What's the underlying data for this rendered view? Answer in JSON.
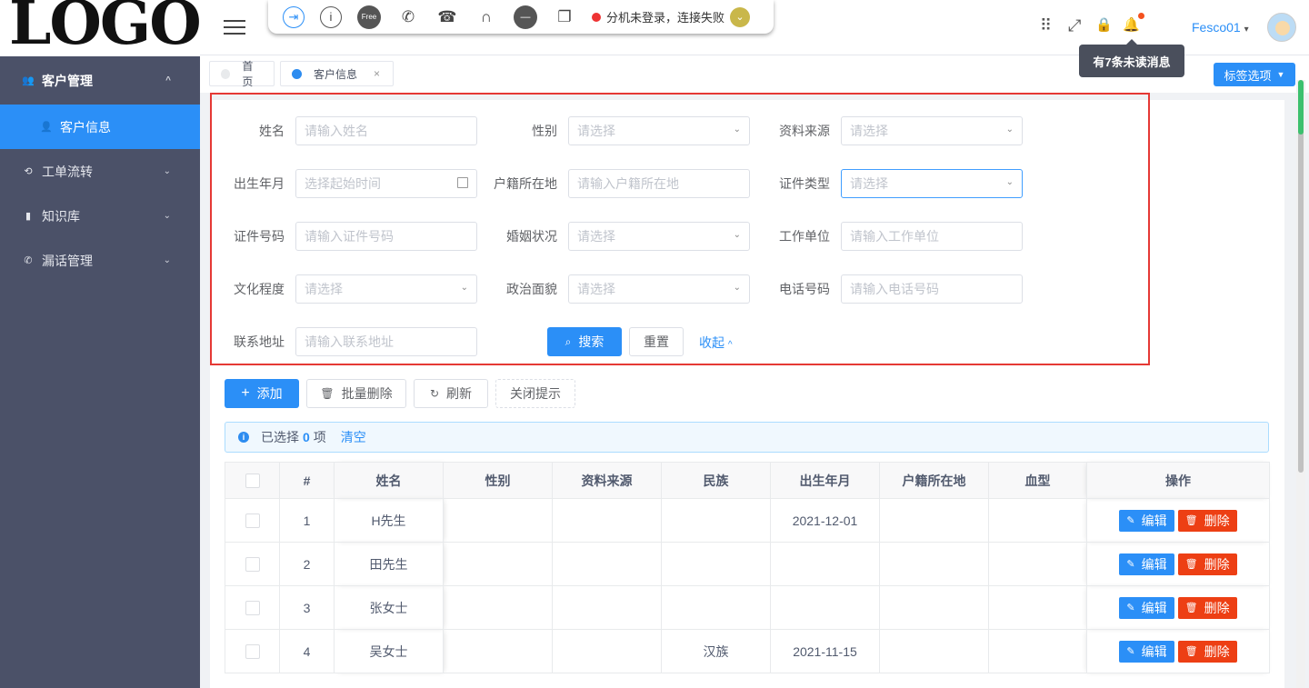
{
  "logo": {
    "text": "LOGO"
  },
  "sidebar": {
    "items": [
      {
        "label": "客户管理",
        "icon": "users-icon",
        "glyph": "👥",
        "chevron": "^"
      },
      {
        "label": "客户信息",
        "icon": "user-add-icon",
        "glyph": "👤"
      },
      {
        "label": "工单流转",
        "icon": "workflow-icon",
        "glyph": "⟲",
        "chevron": "⌄"
      },
      {
        "label": "知识库",
        "icon": "book-icon",
        "glyph": "▮",
        "chevron": "⌄"
      },
      {
        "label": "漏话管理",
        "icon": "phone-icon",
        "glyph": "✆",
        "chevron": "⌄"
      }
    ]
  },
  "toolbar": {
    "icons": [
      {
        "name": "login-icon",
        "glyph": "⇥"
      },
      {
        "name": "info-icon",
        "glyph": "i"
      },
      {
        "name": "free-icon",
        "glyph": "Free"
      },
      {
        "name": "phone-icon",
        "glyph": "✆"
      },
      {
        "name": "hangup-icon",
        "glyph": "☎"
      },
      {
        "name": "headset-icon",
        "glyph": "∩"
      },
      {
        "name": "minus-circle-icon",
        "glyph": "—"
      },
      {
        "name": "copy-icon",
        "glyph": "❐"
      }
    ],
    "status_text": "分机未登录，连接失败",
    "status_icon": "chevron-down-icon",
    "status_glyph": "⌄"
  },
  "header": {
    "username": "Fesco01",
    "username_caret": "▾",
    "tooltip": "有7条未读消息",
    "right_icons": [
      {
        "name": "apps-icon",
        "glyph": "⠿"
      },
      {
        "name": "fullscreen-icon",
        "glyph": "⤢"
      },
      {
        "name": "lock-icon",
        "glyph": "🔒"
      },
      {
        "name": "bell-icon",
        "glyph": "🔔"
      }
    ]
  },
  "tabs": {
    "items": [
      {
        "label": "首页",
        "active": false
      },
      {
        "label": "客户信息",
        "active": true,
        "close": "×"
      }
    ],
    "options_label": "标签选项",
    "options_caret": "▼"
  },
  "search": {
    "fields": [
      {
        "label": "姓名",
        "placeholder": "请输入姓名",
        "type": "input"
      },
      {
        "label": "性别",
        "placeholder": "请选择",
        "type": "select"
      },
      {
        "label": "资料来源",
        "placeholder": "请选择",
        "type": "select"
      },
      {
        "label": "出生年月",
        "placeholder": "选择起始时间",
        "type": "date"
      },
      {
        "label": "户籍所在地",
        "placeholder": "请输入户籍所在地",
        "type": "input"
      },
      {
        "label": "证件类型",
        "placeholder": "请选择",
        "type": "select"
      },
      {
        "label": "证件号码",
        "placeholder": "请输入证件号码",
        "type": "input"
      },
      {
        "label": "婚姻状况",
        "placeholder": "请选择",
        "type": "select"
      },
      {
        "label": "工作单位",
        "placeholder": "请输入工作单位",
        "type": "input"
      },
      {
        "label": "文化程度",
        "placeholder": "请选择",
        "type": "select"
      },
      {
        "label": "政治面貌",
        "placeholder": "请选择",
        "type": "select"
      },
      {
        "label": "电话号码",
        "placeholder": "请输入电话号码",
        "type": "input"
      },
      {
        "label": "联系地址",
        "placeholder": "请输入联系地址",
        "type": "input"
      }
    ],
    "search_label": "搜索",
    "reset_label": "重置",
    "collapse_label": "收起",
    "collapse_caret": "^",
    "select_caret": "⌄"
  },
  "actions": {
    "add_label": "添加",
    "add_glyph": "+",
    "batch_delete_label": "批量删除",
    "batch_delete_glyph": "🗑",
    "refresh_label": "刷新",
    "refresh_glyph": "↻",
    "close_hint_label": "关闭提示"
  },
  "alert": {
    "prefix": "已选择",
    "count": "0",
    "suffix": "项",
    "clear_label": "清空",
    "icon_glyph": "i"
  },
  "table": {
    "columns": [
      "#",
      "姓名",
      "性别",
      "资料来源",
      "民族",
      "出生年月",
      "户籍所在地",
      "血型",
      "操作"
    ],
    "rows": [
      {
        "idx": "1",
        "name": "H先生",
        "gender": "",
        "source": "",
        "ethnic": "",
        "birth": "2021-12-01",
        "hukou": "",
        "blood": ""
      },
      {
        "idx": "2",
        "name": "田先生",
        "gender": "",
        "source": "",
        "ethnic": "",
        "birth": "",
        "hukou": "",
        "blood": ""
      },
      {
        "idx": "3",
        "name": "张女士",
        "gender": "",
        "source": "",
        "ethnic": "",
        "birth": "",
        "hukou": "",
        "blood": ""
      },
      {
        "idx": "4",
        "name": "吴女士",
        "gender": "",
        "source": "",
        "ethnic": "汉族",
        "birth": "2021-11-15",
        "hukou": "",
        "blood": ""
      }
    ],
    "edit_label": "编辑",
    "edit_glyph": "✎",
    "delete_label": "删除",
    "delete_glyph": "🗑"
  }
}
